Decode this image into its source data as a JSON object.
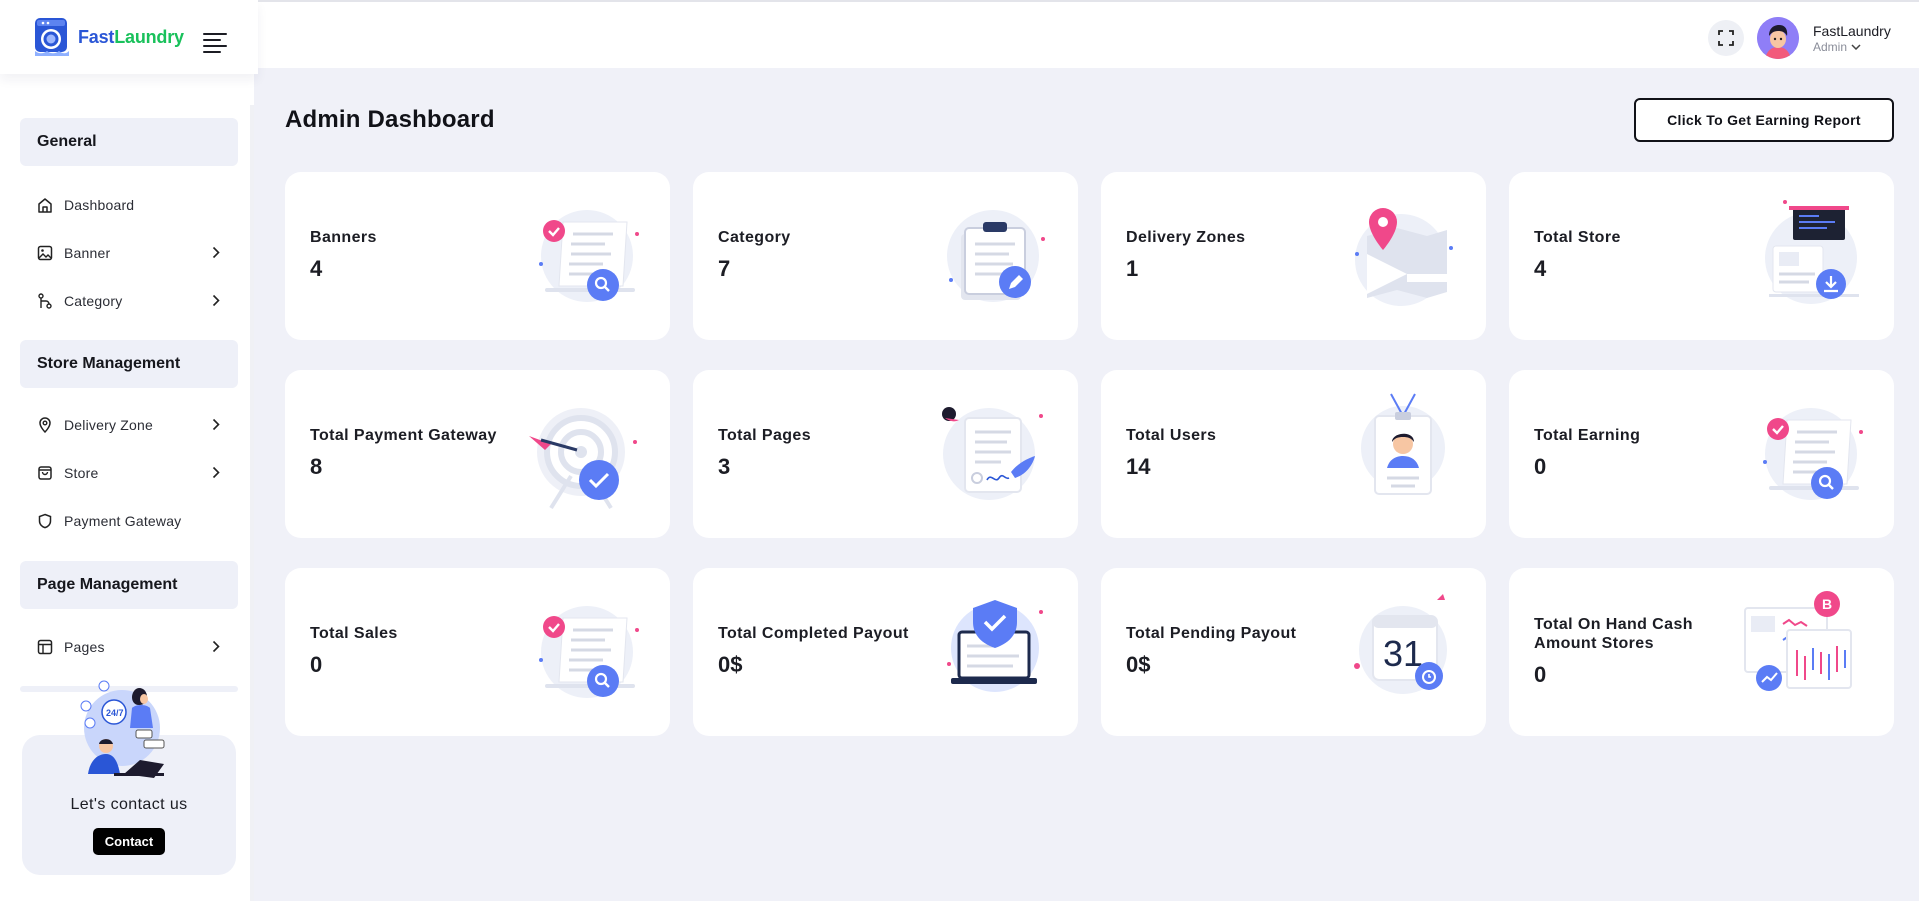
{
  "brand": {
    "name_part1": "Fast",
    "name_part2": "Laundry"
  },
  "header": {
    "user_name": "FastLaundry",
    "user_role": "Admin"
  },
  "sidebar": {
    "sections": [
      {
        "title": "General",
        "items": [
          {
            "label": "Dashboard",
            "icon": "home-icon",
            "has_submenu": false
          },
          {
            "label": "Banner",
            "icon": "image-icon",
            "has_submenu": true
          },
          {
            "label": "Category",
            "icon": "branch-icon",
            "has_submenu": true
          }
        ]
      },
      {
        "title": "Store Management",
        "items": [
          {
            "label": "Delivery Zone",
            "icon": "map-pin-icon",
            "has_submenu": true
          },
          {
            "label": "Store",
            "icon": "bag-icon",
            "has_submenu": true
          },
          {
            "label": "Payment Gateway",
            "icon": "shield-icon",
            "has_submenu": false
          }
        ]
      },
      {
        "title": "Page Management",
        "items": [
          {
            "label": "Pages",
            "icon": "layout-icon",
            "has_submenu": true
          }
        ]
      }
    ],
    "contact": {
      "title": "Let's contact us",
      "button": "Contact"
    }
  },
  "main": {
    "title": "Admin Dashboard",
    "report_button": "Click To Get Earning Report",
    "cards": [
      {
        "title": "Banners",
        "value": "4",
        "illustration": "document-search-illustration"
      },
      {
        "title": "Category",
        "value": "7",
        "illustration": "clipboard-pen-illustration"
      },
      {
        "title": "Delivery Zones",
        "value": "1",
        "illustration": "map-pin-illustration"
      },
      {
        "title": "Total Store",
        "value": "4",
        "illustration": "download-screen-illustration"
      },
      {
        "title": "Total Payment Gateway",
        "value": "8",
        "illustration": "target-check-illustration"
      },
      {
        "title": "Total Pages",
        "value": "3",
        "illustration": "signed-document-illustration"
      },
      {
        "title": "Total Users",
        "value": "14",
        "illustration": "id-badge-illustration"
      },
      {
        "title": "Total Earning",
        "value": "0",
        "illustration": "document-search-illustration"
      },
      {
        "title": "Total Sales",
        "value": "0",
        "illustration": "document-search-illustration"
      },
      {
        "title": "Total Completed Payout",
        "value": "0$",
        "illustration": "laptop-shield-illustration"
      },
      {
        "title": "Total Pending Payout",
        "value": "0$",
        "illustration": "calendar-alarm-illustration"
      },
      {
        "title": "Total On Hand Cash Amount Stores",
        "value": "0",
        "illustration": "bitcoin-chart-illustration"
      }
    ]
  },
  "colors": {
    "accent": "#5b7cf5",
    "pink": "#f0488a",
    "brand_blue": "#2a56d6",
    "brand_green": "#19c15b",
    "background": "#f0f1f8"
  },
  "calendar_day": "31"
}
